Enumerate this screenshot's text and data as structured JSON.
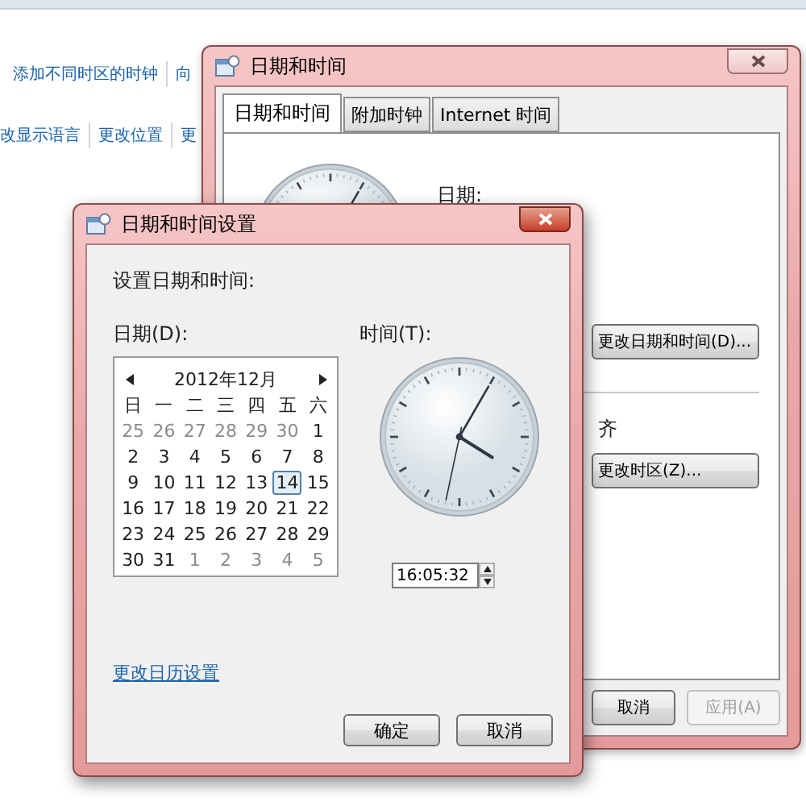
{
  "page": {
    "links_row_1": [
      "添加不同时区的时钟",
      "向"
    ],
    "links_row_2": [
      "改显示语言",
      "更改位置",
      "更"
    ]
  },
  "back_window": {
    "title": "日期和时间",
    "tabs": [
      {
        "label": "日期和时间",
        "selected": true
      },
      {
        "label": "附加时钟",
        "selected": false
      },
      {
        "label": "Internet 时间",
        "selected": false
      }
    ],
    "date_label": "日期:",
    "change_datetime_button": "更改日期和时间(D)...",
    "timezone_fragment": "齐",
    "change_timezone_button": "更改时区(Z)...",
    "buttons": [
      {
        "label": "取消",
        "disabled": false
      },
      {
        "label": "应用(A)",
        "disabled": true
      }
    ]
  },
  "front_window": {
    "title": "日期和时间设置",
    "heading": "设置日期和时间:",
    "date_label": "日期(D):",
    "time_label": "时间(T):",
    "calendar": {
      "month_title": "2012年12月",
      "weekdays": [
        "日",
        "一",
        "二",
        "三",
        "四",
        "五",
        "六"
      ],
      "weeks": [
        [
          {
            "day": "25",
            "current_month": false,
            "selected": false
          },
          {
            "day": "26",
            "current_month": false,
            "selected": false
          },
          {
            "day": "27",
            "current_month": false,
            "selected": false
          },
          {
            "day": "28",
            "current_month": false,
            "selected": false
          },
          {
            "day": "29",
            "current_month": false,
            "selected": false
          },
          {
            "day": "30",
            "current_month": false,
            "selected": false
          },
          {
            "day": "1",
            "current_month": true,
            "selected": false
          }
        ],
        [
          {
            "day": "2",
            "current_month": true,
            "selected": false
          },
          {
            "day": "3",
            "current_month": true,
            "selected": false
          },
          {
            "day": "4",
            "current_month": true,
            "selected": false
          },
          {
            "day": "5",
            "current_month": true,
            "selected": false
          },
          {
            "day": "6",
            "current_month": true,
            "selected": false
          },
          {
            "day": "7",
            "current_month": true,
            "selected": false
          },
          {
            "day": "8",
            "current_month": true,
            "selected": false
          }
        ],
        [
          {
            "day": "9",
            "current_month": true,
            "selected": false
          },
          {
            "day": "10",
            "current_month": true,
            "selected": false
          },
          {
            "day": "11",
            "current_month": true,
            "selected": false
          },
          {
            "day": "12",
            "current_month": true,
            "selected": false
          },
          {
            "day": "13",
            "current_month": true,
            "selected": false
          },
          {
            "day": "14",
            "current_month": true,
            "selected": true
          },
          {
            "day": "15",
            "current_month": true,
            "selected": false
          }
        ],
        [
          {
            "day": "16",
            "current_month": true,
            "selected": false
          },
          {
            "day": "17",
            "current_month": true,
            "selected": false
          },
          {
            "day": "18",
            "current_month": true,
            "selected": false
          },
          {
            "day": "19",
            "current_month": true,
            "selected": false
          },
          {
            "day": "20",
            "current_month": true,
            "selected": false
          },
          {
            "day": "21",
            "current_month": true,
            "selected": false
          },
          {
            "day": "22",
            "current_month": true,
            "selected": false
          }
        ],
        [
          {
            "day": "23",
            "current_month": true,
            "selected": false
          },
          {
            "day": "24",
            "current_month": true,
            "selected": false
          },
          {
            "day": "25",
            "current_month": true,
            "selected": false
          },
          {
            "day": "26",
            "current_month": true,
            "selected": false
          },
          {
            "day": "27",
            "current_month": true,
            "selected": false
          },
          {
            "day": "28",
            "current_month": true,
            "selected": false
          },
          {
            "day": "29",
            "current_month": true,
            "selected": false
          }
        ],
        [
          {
            "day": "30",
            "current_month": true,
            "selected": false
          },
          {
            "day": "31",
            "current_month": true,
            "selected": false
          },
          {
            "day": "1",
            "current_month": false,
            "selected": false
          },
          {
            "day": "2",
            "current_month": false,
            "selected": false
          },
          {
            "day": "3",
            "current_month": false,
            "selected": false
          },
          {
            "day": "4",
            "current_month": false,
            "selected": false
          },
          {
            "day": "5",
            "current_month": false,
            "selected": false
          }
        ]
      ]
    },
    "time_value": "16:05:32",
    "calendar_settings_link": "更改日历设置",
    "buttons": [
      {
        "label": "确定"
      },
      {
        "label": "取消"
      }
    ]
  }
}
